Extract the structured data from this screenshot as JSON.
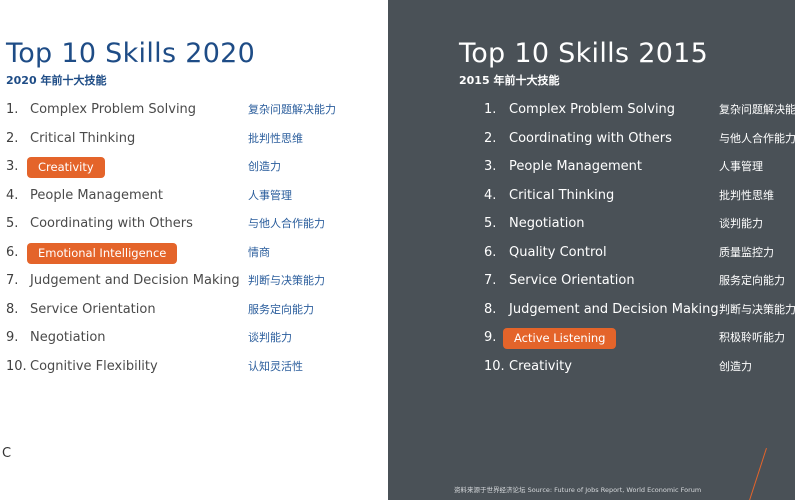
{
  "left": {
    "title": "Top 10 Skills 2020",
    "subtitle": "2020 年前十大技能",
    "skills": [
      {
        "num": "1.",
        "label": "Complex Problem Solving",
        "zh": "复杂问题解决能力",
        "highlight": false
      },
      {
        "num": "2.",
        "label": "Critical Thinking",
        "zh": "批判性思维",
        "highlight": false
      },
      {
        "num": "3.",
        "label": "Creativity",
        "zh": "创造力",
        "highlight": true
      },
      {
        "num": "4.",
        "label": "People Management",
        "zh": "人事管理",
        "highlight": false
      },
      {
        "num": "5.",
        "label": "Coordinating with Others",
        "zh": "与他人合作能力",
        "highlight": false
      },
      {
        "num": "6.",
        "label": "Emotional Intelligence",
        "zh": "情商",
        "highlight": true
      },
      {
        "num": "7.",
        "label": "Judgement and Decision Making",
        "zh": "判断与决策能力",
        "highlight": false
      },
      {
        "num": "8.",
        "label": "Service Orientation",
        "zh": "服务定向能力",
        "highlight": false
      },
      {
        "num": "9.",
        "label": "Negotiation",
        "zh": "谈判能力",
        "highlight": false
      },
      {
        "num": "10.",
        "label": "Cognitive Flexibility",
        "zh": "认知灵活性",
        "highlight": false
      }
    ],
    "stray_char": "C"
  },
  "right": {
    "title": "Top 10 Skills 2015",
    "subtitle": "2015 年前十大技能",
    "skills": [
      {
        "num": "1.",
        "label": "Complex Problem Solving",
        "zh": "复杂问题解决能",
        "highlight": false
      },
      {
        "num": "2.",
        "label": "Coordinating with Others",
        "zh": "与他人合作能力",
        "highlight": false
      },
      {
        "num": "3.",
        "label": "People Management",
        "zh": "人事管理",
        "highlight": false
      },
      {
        "num": "4.",
        "label": "Critical Thinking",
        "zh": "批判性思维",
        "highlight": false
      },
      {
        "num": "5.",
        "label": "Negotiation",
        "zh": "谈判能力",
        "highlight": false
      },
      {
        "num": "6.",
        "label": "Quality Control",
        "zh": "质量监控力",
        "highlight": false
      },
      {
        "num": "7.",
        "label": "Service Orientation",
        "zh": "服务定向能力",
        "highlight": false
      },
      {
        "num": "8.",
        "label": "Judgement and Decision Making",
        "zh": "判断与决策能力",
        "highlight": false
      },
      {
        "num": "9.",
        "label": "Active Listening",
        "zh": "积极聆听能力",
        "highlight": true
      },
      {
        "num": "10.",
        "label": "Creativity",
        "zh": "创造力",
        "highlight": false
      }
    ],
    "footer": "资料来源于世界经济论坛   Source: Future of Jobs Report, World Economic Forum"
  },
  "colors": {
    "highlight": "#e4642a",
    "left_title": "#1e4c86",
    "left_chinese": "#2a5d9c",
    "right_background": "#4a5157"
  }
}
